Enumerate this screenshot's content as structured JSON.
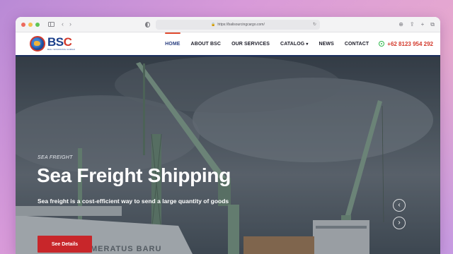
{
  "browser": {
    "url": "https://balisourcingcargo.com/"
  },
  "site": {
    "logo_text_b": "BS",
    "logo_text_c": "C",
    "logo_subtitle": "BALI SOURCING CARGO",
    "nav": [
      {
        "label": "HOME",
        "active": true
      },
      {
        "label": "ABOUT BSC"
      },
      {
        "label": "OUR SERVICES"
      },
      {
        "label": "CATALOG",
        "has_dropdown": true
      },
      {
        "label": "NEWS"
      },
      {
        "label": "CONTACT"
      }
    ],
    "phone": "+62 8123 954 292",
    "colors": {
      "brand_blue": "#1b3f8b",
      "brand_red": "#d33a2c",
      "whatsapp_green": "#2eb84a"
    }
  },
  "hero": {
    "eyebrow": "SEA FREIGHT",
    "title": "Sea Freight Shipping",
    "description": "Sea freight is a cost-efficient way to send a large quantity of goods",
    "button_label": "See Details",
    "ship_name": "MERATUS BARU",
    "prev_icon": "chevron-left-icon",
    "next_icon": "chevron-right-icon"
  }
}
